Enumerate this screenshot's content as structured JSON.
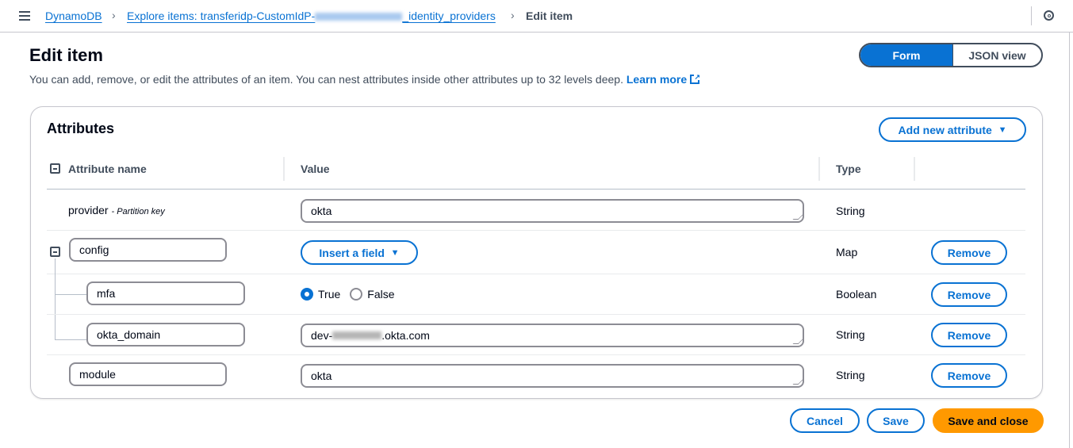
{
  "breadcrumb": {
    "items": [
      "DynamoDB",
      "Explore items: transferidp-CustomIdP-",
      "_identity_providers"
    ],
    "current": "Edit item"
  },
  "page": {
    "title": "Edit item",
    "description": "You can add, remove, or edit the attributes of an item. You can nest attributes inside other attributes up to 32 levels deep.",
    "learn_more": "Learn more"
  },
  "view_toggle": {
    "options": [
      "Form",
      "JSON view"
    ],
    "selected": "Form"
  },
  "attributes": {
    "title": "Attributes",
    "add_button": "Add new attribute",
    "columns": [
      "Attribute name",
      "Value",
      "Type"
    ],
    "rows": [
      {
        "name": "provider",
        "note": "- Partition key",
        "value": "okta",
        "type": "String"
      },
      {
        "name": "config",
        "value_button": "Insert a field",
        "type": "Map",
        "remove": "Remove"
      },
      {
        "name": "mfa",
        "radio": [
          "True",
          "False"
        ],
        "selected": "True",
        "type": "Boolean",
        "remove": "Remove"
      },
      {
        "name": "okta_domain",
        "value_prefix": "dev-",
        "value_suffix": ".okta.com",
        "type": "String",
        "remove": "Remove"
      },
      {
        "name": "module",
        "value": "okta",
        "type": "String",
        "remove": "Remove"
      }
    ]
  },
  "footer": {
    "cancel": "Cancel",
    "save": "Save",
    "save_close": "Save and close"
  },
  "colors": {
    "accent": "#0972d3",
    "primary": "#ff9900"
  }
}
